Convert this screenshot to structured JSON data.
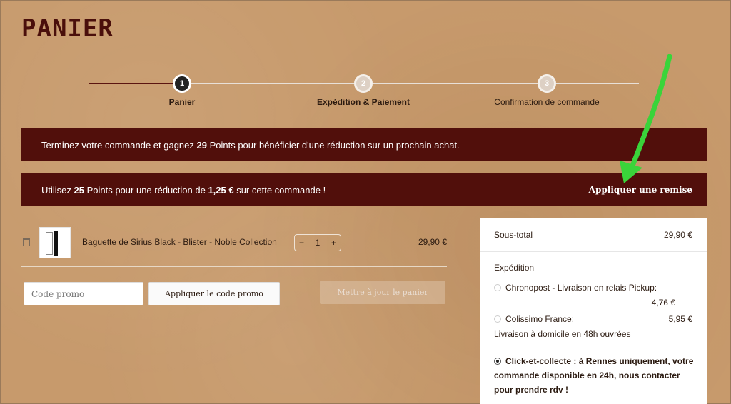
{
  "page": {
    "title": "PANIER"
  },
  "steps": [
    {
      "number": "1",
      "label": "Panier"
    },
    {
      "number": "2",
      "label": "Expédition & Paiement"
    },
    {
      "number": "3",
      "label": "Confirmation de commande"
    }
  ],
  "banners": {
    "points_earn": {
      "prefix": "Terminez votre commande et gagnez ",
      "points": "29",
      "suffix": " Points pour bénéficier d'une réduction sur un prochain achat."
    },
    "points_use": {
      "prefix": "Utilisez ",
      "points": "25",
      "middle": " Points pour une réduction de ",
      "amount": "1,25 €",
      "suffix": " sur cette commande !",
      "action": "Appliquer une remise"
    }
  },
  "cart": {
    "items": [
      {
        "name": "Baguette de Sirius Black - Blister - Noble Collection",
        "quantity": "1",
        "minus": "−",
        "plus": "+",
        "price": "29,90 €"
      }
    ]
  },
  "promo": {
    "placeholder": "Code promo",
    "apply_label": "Appliquer le code promo",
    "update_label": "Mettre à jour le panier"
  },
  "summary": {
    "subtotal_label": "Sous-total",
    "subtotal_value": "29,90 €",
    "shipping_label": "Expédition",
    "options": [
      {
        "label": "Chronopost - Livraison en relais Pickup:",
        "price": "4,76 €"
      },
      {
        "label": "Colissimo France:",
        "price": "5,95 €",
        "detail": "Livraison à domicile en 48h ouvrées"
      },
      {
        "label": "Click-et-collecte : à Rennes uniquement, votre commande disponible en 24h, nous contacter pour prendre rdv !",
        "selected": true
      }
    ]
  },
  "colors": {
    "accent": "#510f0b",
    "background": "#c79a6c",
    "annotation_arrow": "#3ad43a"
  }
}
